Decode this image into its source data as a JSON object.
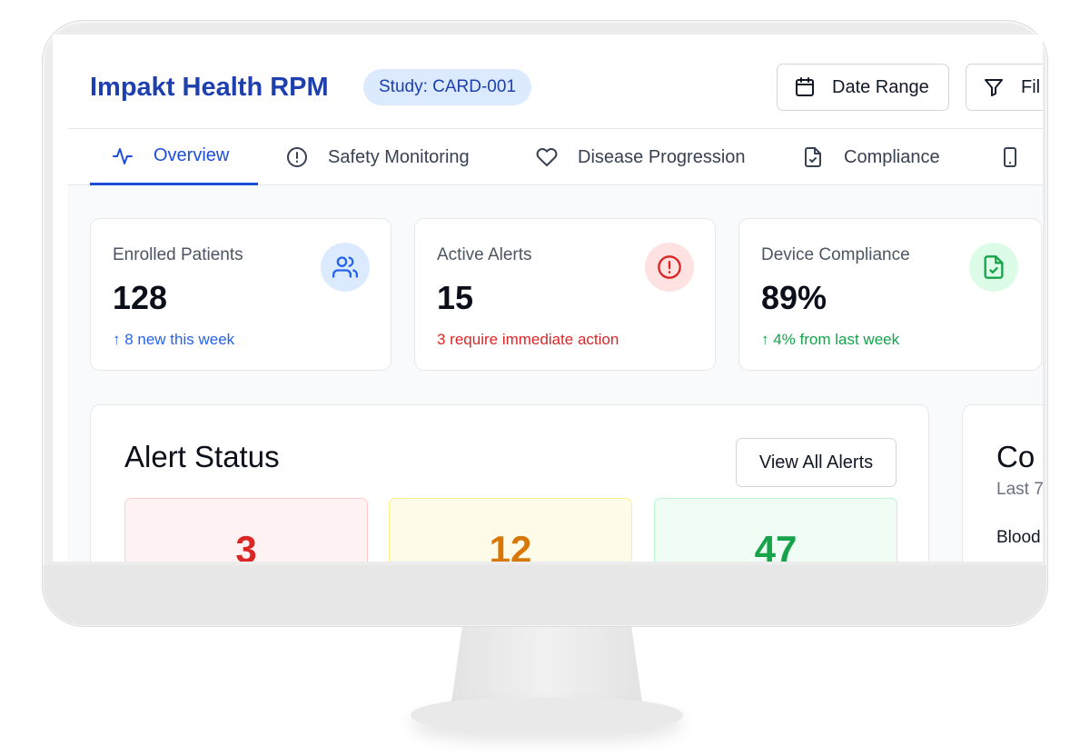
{
  "header": {
    "title": "Impakt Health RPM",
    "study_badge": "Study: CARD-001",
    "date_range_label": "Date Range",
    "filter_label": "Fil"
  },
  "tabs": [
    {
      "label": "Overview",
      "icon": "activity-icon",
      "active": true
    },
    {
      "label": "Safety Monitoring",
      "icon": "alert-circle-icon",
      "active": false
    },
    {
      "label": "Disease Progression",
      "icon": "heart-icon",
      "active": false
    },
    {
      "label": "Compliance",
      "icon": "file-check-icon",
      "active": false
    },
    {
      "label": "",
      "icon": "smartphone-icon",
      "active": false
    }
  ],
  "stats": {
    "enrolled": {
      "label": "Enrolled Patients",
      "value": "128",
      "sub": "↑ 8 new this week",
      "color": "#2563eb",
      "icon": "users-icon"
    },
    "alerts": {
      "label": "Active Alerts",
      "value": "15",
      "sub": "3 require immediate action",
      "color": "#dc2626",
      "icon": "alert-circle-icon"
    },
    "device": {
      "label": "Device Compliance",
      "value": "89%",
      "sub": "↑ 4% from last week",
      "color": "#16a34a",
      "icon": "file-check-icon"
    }
  },
  "alert_status": {
    "title": "Alert Status",
    "view_all_label": "View All Alerts",
    "boxes": [
      {
        "value": "3",
        "color": "#dc2626"
      },
      {
        "value": "12",
        "color": "#d97706"
      },
      {
        "value": "47",
        "color": "#16a34a"
      }
    ]
  },
  "compliance_panel": {
    "title": "Co",
    "subtitle": "Last 7",
    "first_row": "Blood"
  }
}
